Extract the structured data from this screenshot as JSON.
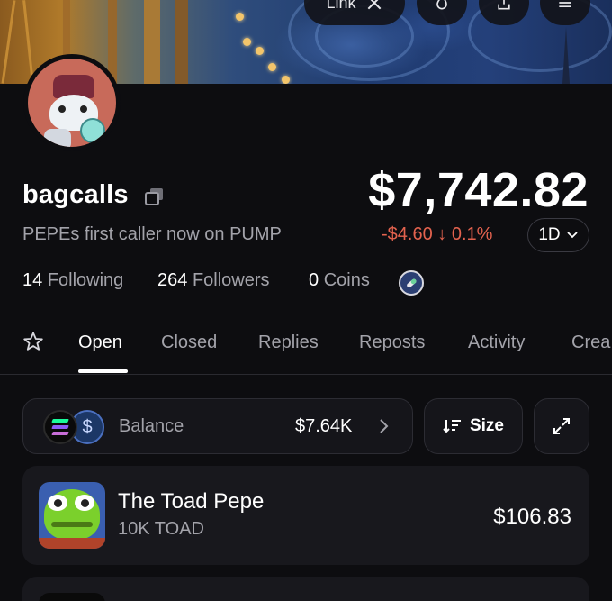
{
  "header": {
    "link_label": "Link",
    "buttons": [
      "x-icon",
      "flame-icon",
      "share-icon",
      "menu-icon"
    ]
  },
  "profile": {
    "username": "bagcalls",
    "bio": "PEPEs first caller now on PUMP",
    "portfolio_value": "$7,742.82",
    "change": "-$4.60 ↓ 0.1%",
    "range": "1D",
    "stats": [
      {
        "count": "14",
        "label": "Following"
      },
      {
        "count": "264",
        "label": "Followers"
      },
      {
        "count": "0",
        "label": "Coins"
      }
    ]
  },
  "tabs": [
    "Open",
    "Closed",
    "Replies",
    "Reposts",
    "Activity",
    "Crea"
  ],
  "active_tab": "Open",
  "balance": {
    "label": "Balance",
    "value": "$7.64K"
  },
  "controls": {
    "size_label": "Size"
  },
  "holdings": [
    {
      "name": "The Toad Pepe",
      "amount": "10K TOAD",
      "value": "$106.83"
    }
  ],
  "colors": {
    "background": "#0d0d10",
    "negative": "#e2624e",
    "muted_text": "#a3a3aa"
  }
}
